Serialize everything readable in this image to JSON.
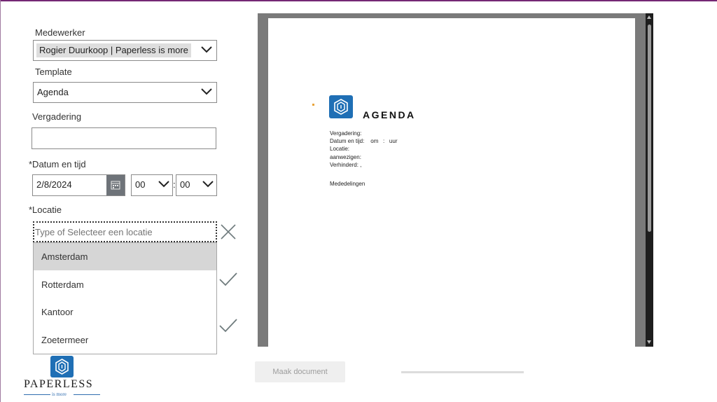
{
  "form": {
    "medewerker_label": "Medewerker",
    "medewerker_value": "Rogier Duurkoop | Paperless is more",
    "template_label": "Template",
    "template_value": "Agenda",
    "vergadering_label": "Vergadering",
    "vergadering_value": "",
    "datum_label": "*Datum en tijd",
    "datum_value": "2/8/2024",
    "hour_value": "00",
    "time_sep": ":",
    "minute_value": "00",
    "locatie_label": "*Locatie",
    "locatie_placeholder": "Type of Selecteer een locatie",
    "locatie_options": [
      "Amsterdam",
      "Rotterdam",
      "Kantoor",
      "Zoetermeer"
    ],
    "locatie_selected": "Amsterdam"
  },
  "preview": {
    "title": "AGENDA",
    "lines": {
      "vergadering": "Vergadering:",
      "datum": "Datum en tijd:    om   :   uur",
      "locatie": "Locatie:",
      "aanwezigen": "aanwezigen:",
      "verhinderd": "Verhinderd: ,",
      "mededelingen": "Mededelingen"
    }
  },
  "actions": {
    "maak_document": "Maak document"
  },
  "brand": {
    "name": "PAPERLESS",
    "tagline": "is more"
  },
  "colors": {
    "brand_blue": "#1f6fb5",
    "accent_purple": "#742774",
    "check_gray": "#6f7b7d"
  }
}
